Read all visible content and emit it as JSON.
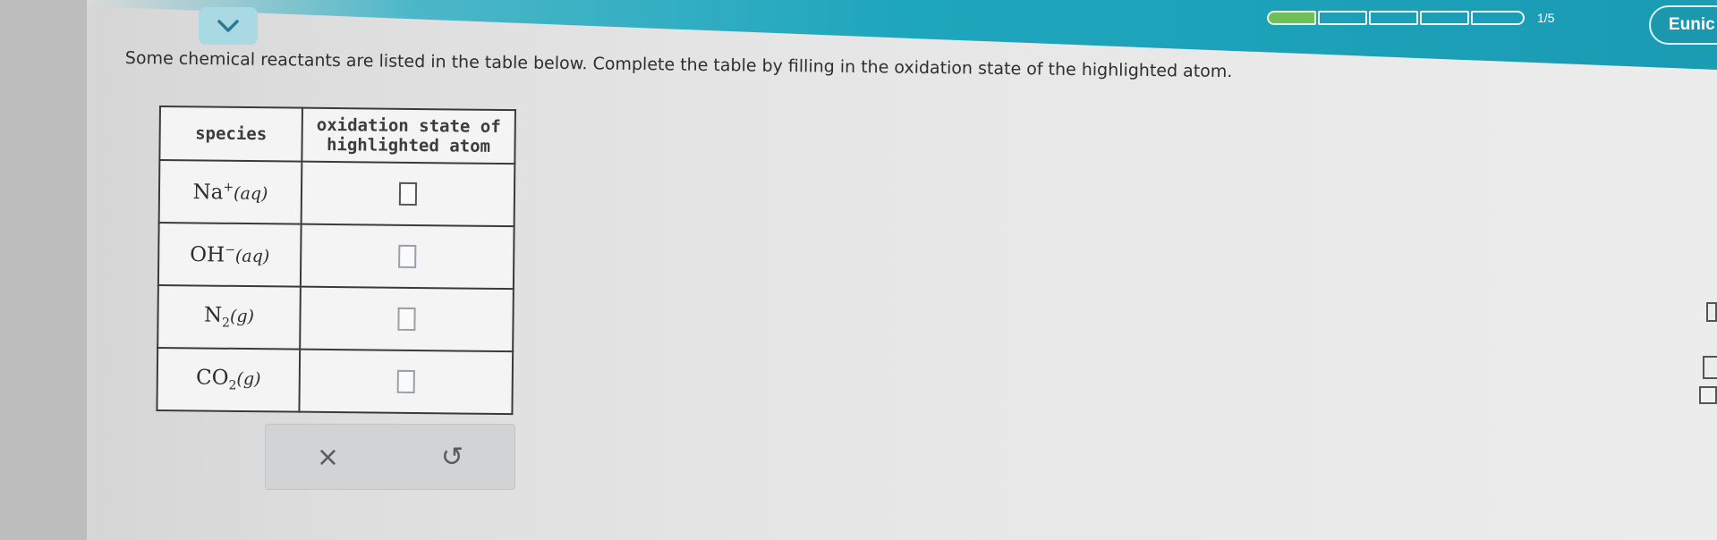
{
  "header": {
    "collapse_icon": "chevron-down-icon",
    "progress": {
      "segments_total": 5,
      "segments_done": 1,
      "label": "1/5"
    },
    "user_name": "Eunic"
  },
  "question": {
    "prompt": "Some chemical reactants are listed in the table below. Complete the table by filling in the oxidation state of the highlighted atom."
  },
  "table": {
    "headers": [
      "species",
      "oxidation state of highlighted atom"
    ],
    "header_line1": "oxidation state of",
    "header_line2": "highlighted atom",
    "rows": [
      {
        "base": "Na",
        "sup": "+",
        "sub": "",
        "phase": "(aq)",
        "answer": ""
      },
      {
        "base": "OH",
        "sup": "−",
        "sub": "",
        "phase": "(aq)",
        "answer": ""
      },
      {
        "base": "N",
        "sup": "",
        "sub": "2",
        "phase": "(g)",
        "answer": ""
      },
      {
        "base": "CO",
        "sup": "",
        "sub": "2",
        "phase": "(g)",
        "answer": ""
      }
    ]
  },
  "actions": {
    "clear_symbol": "×",
    "undo_symbol": "↺",
    "clear_icon": "close-icon",
    "undo_icon": "undo-icon"
  },
  "colors": {
    "topbar": "#1ea6bd",
    "progress_done": "#6fbf5a",
    "table_border": "#3a3a3a"
  }
}
